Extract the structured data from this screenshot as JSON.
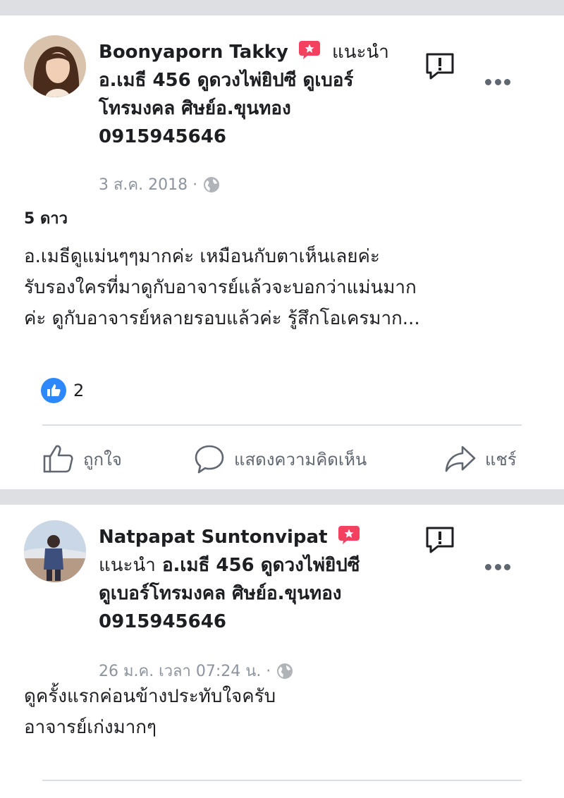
{
  "posts": [
    {
      "author": "Boonyaporn Takky",
      "recommend_prefix": "แนะนำ",
      "page_lines": [
        "อ.เมธี 456 ดูดวงไพ่ยิปซี ดูเบอร์",
        "โทรมงคล ศิษย์อ.ขุนทอง",
        "0915945646"
      ],
      "date": "3 ส.ค. 2018 ·",
      "stars": "5 ดาว",
      "text_lines": [
        "อ.เมธีดูแม่นๆๆมากค่ะ เหมือนกับตาเห็นเลยค่ะ",
        "รับรองใครที่มาดูกับอาจารย์แล้วจะบอกว่าแม่นมาก",
        "ค่ะ ดูกับอาจารย์หลายรอบแล้วค่ะ รู้สึกโอเครมาก..."
      ],
      "like_count": "2",
      "actions": {
        "like": "ถูกใจ",
        "comment": "แสดงความคิดเห็น",
        "share": "แชร์"
      }
    },
    {
      "author": "Natpapat Suntonvipat",
      "recommend_prefix": "แนะนำ",
      "page_lines": [
        "อ.เมธี 456 ดูดวงไพ่ยิปซี",
        "ดูเบอร์โทรมงคล ศิษย์อ.ขุนทอง",
        "0915945646"
      ],
      "date": "26 ม.ค. เวลา 07:24 น. ·",
      "text_lines": [
        "ดูครั้งแรกค่อนข้างประทับใจครับ",
        "อาจารย์เก่งมากๆ"
      ]
    }
  ],
  "colors": {
    "recommend_badge": "#f3425f",
    "like_blue": "#2d88ff",
    "meta_gray": "#8d949e"
  },
  "icons": [
    "recommend-badge-icon",
    "report-icon",
    "more-icon",
    "globe-icon",
    "like-icon",
    "comment-icon",
    "share-icon"
  ]
}
